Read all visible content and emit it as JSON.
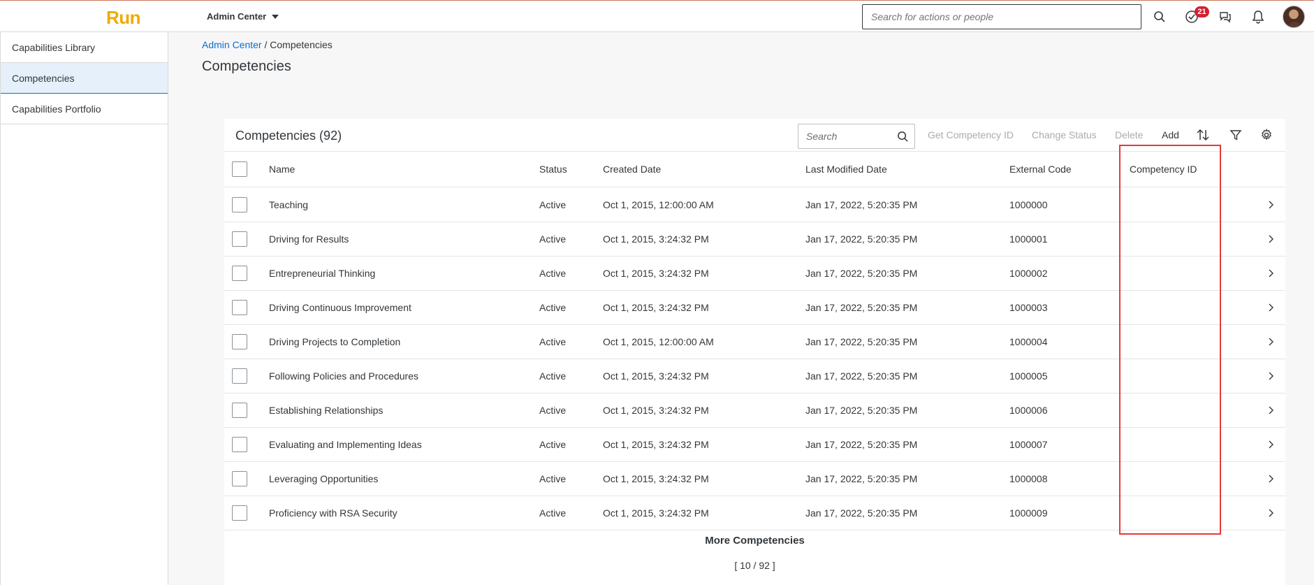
{
  "shell": {
    "logo": "Run",
    "app_menu": "Admin Center",
    "search_placeholder": "Search for actions or people",
    "todo_badge": "21",
    "icons": [
      "search-icon",
      "todo-icon",
      "chat-icon",
      "notification-bell-icon",
      "user-avatar"
    ]
  },
  "sidenav": {
    "items": [
      {
        "label": "Capabilities Library"
      },
      {
        "label": "Competencies"
      },
      {
        "label": "Capabilities Portfolio"
      }
    ],
    "active_index": 1
  },
  "breadcrumb": {
    "parent": "Admin Center",
    "separator": " / ",
    "current": "Competencies"
  },
  "page_title": "Competencies",
  "table": {
    "title": "Competencies (92)",
    "search_placeholder": "Search",
    "actions": {
      "get_id": "Get Competency ID",
      "change_status": "Change Status",
      "delete": "Delete",
      "add": "Add"
    },
    "columns": {
      "name": "Name",
      "status": "Status",
      "created": "Created Date",
      "modified": "Last Modified Date",
      "external_code": "External Code",
      "competency_id": "Competency ID"
    },
    "rows": [
      {
        "name": "Teaching",
        "status": "Active",
        "created": "Oct 1, 2015, 12:00:00 AM",
        "modified": "Jan 17, 2022, 5:20:35 PM",
        "external_code": "1000000",
        "competency_id": ""
      },
      {
        "name": "Driving for Results",
        "status": "Active",
        "created": "Oct 1, 2015, 3:24:32 PM",
        "modified": "Jan 17, 2022, 5:20:35 PM",
        "external_code": "1000001",
        "competency_id": ""
      },
      {
        "name": "Entrepreneurial Thinking",
        "status": "Active",
        "created": "Oct 1, 2015, 3:24:32 PM",
        "modified": "Jan 17, 2022, 5:20:35 PM",
        "external_code": "1000002",
        "competency_id": ""
      },
      {
        "name": "Driving Continuous Improvement",
        "status": "Active",
        "created": "Oct 1, 2015, 3:24:32 PM",
        "modified": "Jan 17, 2022, 5:20:35 PM",
        "external_code": "1000003",
        "competency_id": ""
      },
      {
        "name": "Driving Projects to Completion",
        "status": "Active",
        "created": "Oct 1, 2015, 12:00:00 AM",
        "modified": "Jan 17, 2022, 5:20:35 PM",
        "external_code": "1000004",
        "competency_id": ""
      },
      {
        "name": "Following Policies and Procedures",
        "status": "Active",
        "created": "Oct 1, 2015, 3:24:32 PM",
        "modified": "Jan 17, 2022, 5:20:35 PM",
        "external_code": "1000005",
        "competency_id": ""
      },
      {
        "name": "Establishing Relationships",
        "status": "Active",
        "created": "Oct 1, 2015, 3:24:32 PM",
        "modified": "Jan 17, 2022, 5:20:35 PM",
        "external_code": "1000006",
        "competency_id": ""
      },
      {
        "name": "Evaluating and Implementing Ideas",
        "status": "Active",
        "created": "Oct 1, 2015, 3:24:32 PM",
        "modified": "Jan 17, 2022, 5:20:35 PM",
        "external_code": "1000007",
        "competency_id": ""
      },
      {
        "name": "Leveraging Opportunities",
        "status": "Active",
        "created": "Oct 1, 2015, 3:24:32 PM",
        "modified": "Jan 17, 2022, 5:20:35 PM",
        "external_code": "1000008",
        "competency_id": ""
      },
      {
        "name": "Proficiency with RSA Security",
        "status": "Active",
        "created": "Oct 1, 2015, 3:24:32 PM",
        "modified": "Jan 17, 2022, 5:20:35 PM",
        "external_code": "1000009",
        "competency_id": ""
      }
    ],
    "more_label": "More Competencies",
    "more_count": "[ 10 / 92 ]"
  },
  "colors": {
    "brand_logo": "#f0ab00",
    "link": "#0a6ed1",
    "badge": "#d32030",
    "highlight_box": "#e33a3a",
    "active_nav_bg": "#e5f0fa"
  }
}
